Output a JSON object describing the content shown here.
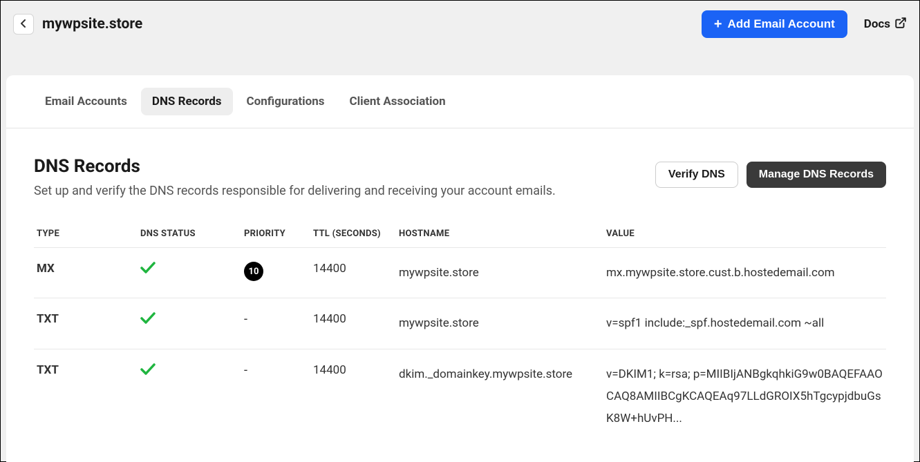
{
  "header": {
    "siteTitle": "mywpsite.store",
    "addEmailLabel": "Add Email Account",
    "docsLabel": "Docs"
  },
  "tabs": [
    {
      "label": "Email Accounts"
    },
    {
      "label": "DNS Records"
    },
    {
      "label": "Configurations"
    },
    {
      "label": "Client Association"
    }
  ],
  "section": {
    "title": "DNS Records",
    "description": "Set up and verify the DNS records responsible for delivering and receiving your account emails.",
    "verifyLabel": "Verify DNS",
    "manageLabel": "Manage DNS Records"
  },
  "table": {
    "headers": {
      "type": "TYPE",
      "status": "DNS STATUS",
      "priority": "PRIORITY",
      "ttl": "TTL (SECONDS)",
      "hostname": "HOSTNAME",
      "value": "VALUE"
    },
    "rows": [
      {
        "type": "MX",
        "status": "ok",
        "priority": "10",
        "priorityBadge": true,
        "ttl": "14400",
        "hostname": "mywpsite.store",
        "value": "mx.mywpsite.store.cust.b.hostedemail.com"
      },
      {
        "type": "TXT",
        "status": "ok",
        "priority": "-",
        "priorityBadge": false,
        "ttl": "14400",
        "hostname": "mywpsite.store",
        "value": "v=spf1 include:_spf.hostedemail.com ~all"
      },
      {
        "type": "TXT",
        "status": "ok",
        "priority": "-",
        "priorityBadge": false,
        "ttl": "14400",
        "hostname": "dkim._domainkey.mywpsite.store",
        "value": "v=DKIM1; k=rsa; p=MIIBIjANBgkqhkiG9w0BAQEFAAOCAQ8AMIIBCgKCAQEAq97LLdGROIX5hTgcypjdbuGsK8W+hUvPH..."
      }
    ]
  }
}
